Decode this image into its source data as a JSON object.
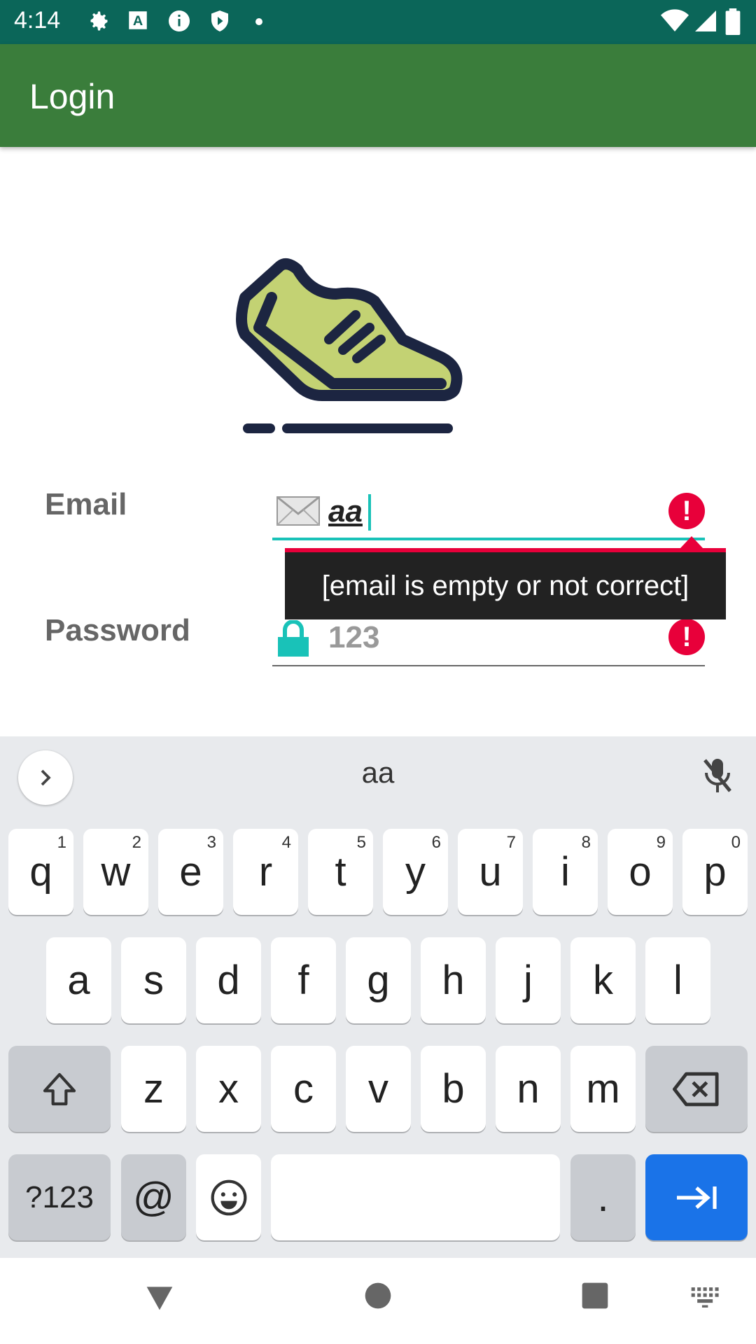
{
  "status_bar": {
    "time": "4:14",
    "left_icons": [
      "settings-icon",
      "a-icon",
      "info-icon",
      "shield-icon",
      "dot-icon"
    ],
    "right_icons": [
      "wifi-icon",
      "signal-icon",
      "battery-icon"
    ]
  },
  "app_bar": {
    "title": "Login"
  },
  "form": {
    "email": {
      "label": "Email",
      "value": "aa",
      "icon": "envelope-icon"
    },
    "password": {
      "label": "Password",
      "value": "123",
      "icon": "lock-icon"
    },
    "error_tooltip": "[email is empty or not correct]"
  },
  "keyboard": {
    "suggestion": "aa",
    "row1": [
      {
        "key": "q",
        "hint": "1"
      },
      {
        "key": "w",
        "hint": "2"
      },
      {
        "key": "e",
        "hint": "3"
      },
      {
        "key": "r",
        "hint": "4"
      },
      {
        "key": "t",
        "hint": "5"
      },
      {
        "key": "y",
        "hint": "6"
      },
      {
        "key": "u",
        "hint": "7"
      },
      {
        "key": "i",
        "hint": "8"
      },
      {
        "key": "o",
        "hint": "9"
      },
      {
        "key": "p",
        "hint": "0"
      }
    ],
    "row2": [
      "a",
      "s",
      "d",
      "f",
      "g",
      "h",
      "j",
      "k",
      "l"
    ],
    "row3": [
      "z",
      "x",
      "c",
      "v",
      "b",
      "n",
      "m"
    ],
    "symbols_label": "?123",
    "at_label": "@",
    "period_label": "."
  },
  "colors": {
    "status_bar": "#0b6659",
    "app_bar": "#3a7d3b",
    "accent": "#19c2b8",
    "error": "#e8003a",
    "shoe_fill": "#c3d273",
    "shoe_outline": "#1c2541",
    "enter_key": "#1a73e8"
  }
}
